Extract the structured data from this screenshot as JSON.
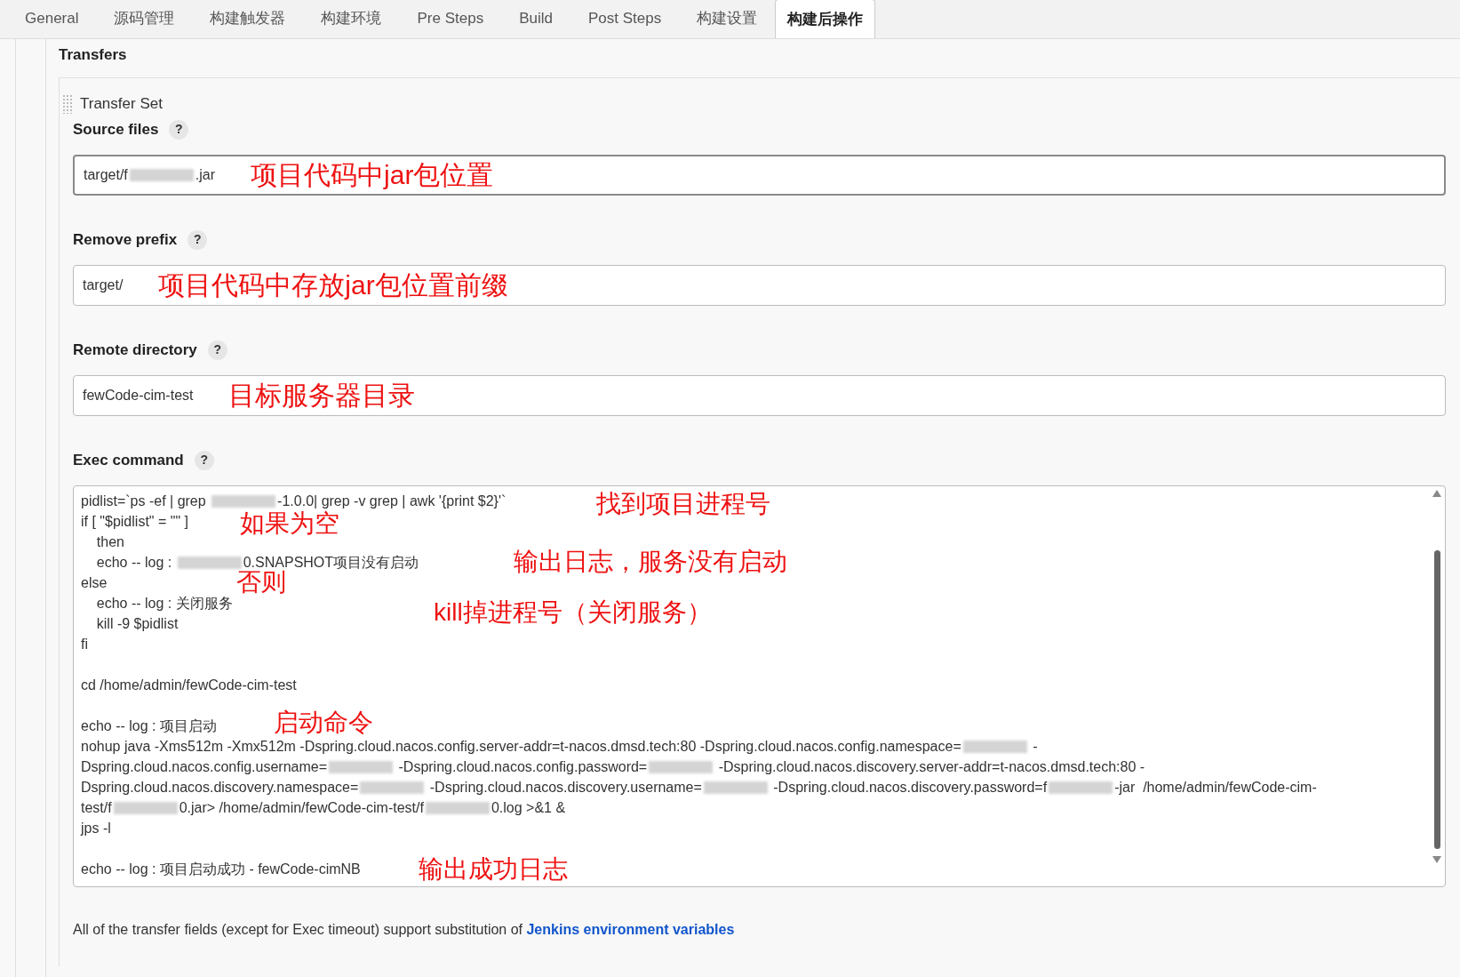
{
  "tabs": [
    {
      "label": "General",
      "selected": false
    },
    {
      "label": "源码管理",
      "selected": false
    },
    {
      "label": "构建触发器",
      "selected": false
    },
    {
      "label": "构建环境",
      "selected": false
    },
    {
      "label": "Pre Steps",
      "selected": false
    },
    {
      "label": "Build",
      "selected": false
    },
    {
      "label": "Post Steps",
      "selected": false
    },
    {
      "label": "构建设置",
      "selected": false
    },
    {
      "label": "构建后操作",
      "selected": true
    }
  ],
  "section_title": "Transfers",
  "transfer_set": {
    "title": "Transfer Set",
    "fields": [
      {
        "label": "Source files",
        "help": "?",
        "value": [
          {
            "kind": "text",
            "text": "target/f"
          },
          {
            "kind": "redacted"
          },
          {
            "kind": "text",
            "text": ".jar"
          }
        ],
        "annotation": "项目代码中jar包位置"
      },
      {
        "label": "Remove prefix",
        "help": "?",
        "value": [
          {
            "kind": "text",
            "text": "target/"
          }
        ],
        "annotation": "项目代码中存放jar包位置前缀"
      },
      {
        "label": "Remote directory",
        "help": "?",
        "value": [
          {
            "kind": "text",
            "text": "fewCode-cim-test"
          }
        ],
        "annotation": "目标服务器目录"
      }
    ],
    "exec_command": {
      "label": "Exec command",
      "help": "?",
      "lines": [
        [
          {
            "kind": "text",
            "text": "pidlist=`ps -ef | grep "
          },
          {
            "kind": "redacted"
          },
          {
            "kind": "text",
            "text": "-1.0.0| grep -v grep | awk '{print $2}'`"
          }
        ],
        [
          {
            "kind": "text",
            "text": "if [ \"$pidlist\" = \"\" ]"
          }
        ],
        [
          {
            "kind": "text",
            "text": "    then"
          }
        ],
        [
          {
            "kind": "text",
            "text": "    echo -- log : "
          },
          {
            "kind": "redacted"
          },
          {
            "kind": "text",
            "text": "0.SNAPSHOT项目没有启动"
          }
        ],
        [
          {
            "kind": "text",
            "text": "else"
          }
        ],
        [
          {
            "kind": "text",
            "text": "    echo -- log : 关闭服务"
          }
        ],
        [
          {
            "kind": "text",
            "text": "    kill -9 $pidlist"
          }
        ],
        [
          {
            "kind": "text",
            "text": "fi"
          }
        ],
        [
          {
            "kind": "blank"
          }
        ],
        [
          {
            "kind": "text",
            "text": "cd /home/admin/fewCode-cim-test"
          }
        ],
        [
          {
            "kind": "blank"
          }
        ],
        [
          {
            "kind": "text",
            "text": "echo -- log : 项目启动"
          }
        ],
        [
          {
            "kind": "text",
            "text": "nohup java -Xms512m -Xmx512m -Dspring.cloud.nacos.config.server-addr=t-nacos.dmsd.tech:80 -Dspring.cloud.nacos.config.namespace="
          },
          {
            "kind": "redacted"
          },
          {
            "kind": "text",
            "text": " -"
          }
        ],
        [
          {
            "kind": "text",
            "text": "Dspring.cloud.nacos.config.username="
          },
          {
            "kind": "redacted"
          },
          {
            "kind": "text",
            "text": " -Dspring.cloud.nacos.config.password="
          },
          {
            "kind": "redacted"
          },
          {
            "kind": "text",
            "text": " -Dspring.cloud.nacos.discovery.server-addr=t-nacos.dmsd.tech:80 -"
          }
        ],
        [
          {
            "kind": "text",
            "text": "Dspring.cloud.nacos.discovery.namespace="
          },
          {
            "kind": "redacted"
          },
          {
            "kind": "text",
            "text": " -Dspring.cloud.nacos.discovery.username="
          },
          {
            "kind": "redacted"
          },
          {
            "kind": "text",
            "text": " -Dspring.cloud.nacos.discovery.password=f"
          },
          {
            "kind": "redacted"
          },
          {
            "kind": "text",
            "text": "-jar  /home/admin/fewCode-cim-"
          }
        ],
        [
          {
            "kind": "text",
            "text": "test/f"
          },
          {
            "kind": "redacted"
          },
          {
            "kind": "text",
            "text": "0.jar> /home/admin/fewCode-cim-test/f"
          },
          {
            "kind": "redacted"
          },
          {
            "kind": "text",
            "text": "0.log >&1 &"
          }
        ],
        [
          {
            "kind": "text",
            "text": "jps -l"
          }
        ],
        [
          {
            "kind": "blank"
          }
        ],
        [
          {
            "kind": "text",
            "text": "echo -- log : 项目启动成功 - fewCode-cimNB"
          }
        ]
      ],
      "annotations": [
        "找到项目进程号",
        "如果为空",
        "输出日志，服务没有启动",
        "否则",
        "kill掉进程号（关闭服务）",
        "启动命令",
        "输出成功日志"
      ]
    }
  },
  "footer": [
    {
      "kind": "text",
      "text": "All of the transfer fields (except for Exec timeout) support substitution of "
    },
    {
      "kind": "link",
      "text": "Jenkins environment variables"
    }
  ]
}
